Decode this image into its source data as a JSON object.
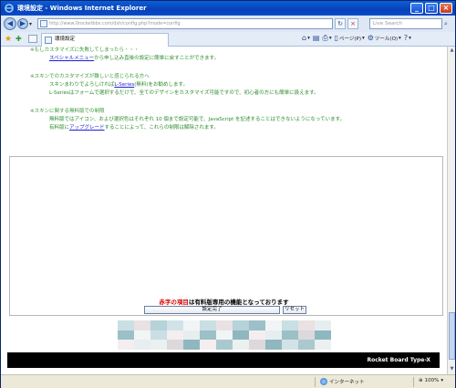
{
  "window": {
    "title": "環境設定 - Windows Internet Explorer"
  },
  "address": {
    "url": "http://www.0rocketbbs.com/dsh/config.php?mode=config",
    "search_placeholder": "Live Search"
  },
  "tab": {
    "label": "環境設定"
  },
  "command_bar": {
    "page_label": "ページ(P)",
    "tools_label": "ツール(O)"
  },
  "notes": [
    {
      "heading": "※もしカスタマイズに失敗してしまったら・・・",
      "lines": [
        {
          "link": "スペシャルメニュー",
          "text": "から申し込み直後の設定に簡単に戻すことができます。"
        }
      ]
    },
    {
      "heading": "※スキンでのカスタマイズが難しいと感じられる方へ",
      "lines": [
        {
          "pre": "スキンまわりでよろしければ",
          "link": "L-Series",
          "text": "(無料)をお勧めします。"
        },
        {
          "text": "L-Seriesはフォームで選択するだけで、全てのデザインをカスタマイズ可能ですので、初心者の方にも簡単に扱えます。"
        }
      ]
    },
    {
      "heading": "※スキンに関する無料版での制限",
      "lines": [
        {
          "text": "無料版ではアイコン、および選択色はそれぞれ 10 個まで設定可能で、JavaScript を記述することはできないようになっています。"
        },
        {
          "pre": "有料版に",
          "link": "アップグレード",
          "text": "することによって、これらの制限は解除されます。"
        }
      ]
    }
  ],
  "form": {
    "notice_red": "赤字の項目",
    "notice_rest": "は有料版専用の機能となっております",
    "submit_label": "設定完了",
    "reset_label": "リセット"
  },
  "footer": {
    "brand": "Rocket Board Type-X"
  },
  "status": {
    "zone": "インターネット",
    "zoom": "100%"
  },
  "colors": {
    "note_green": "#2e8b2e",
    "link_blue": "#1d1dd8",
    "required_red": "#d40000",
    "footer_bg": "#000000"
  }
}
